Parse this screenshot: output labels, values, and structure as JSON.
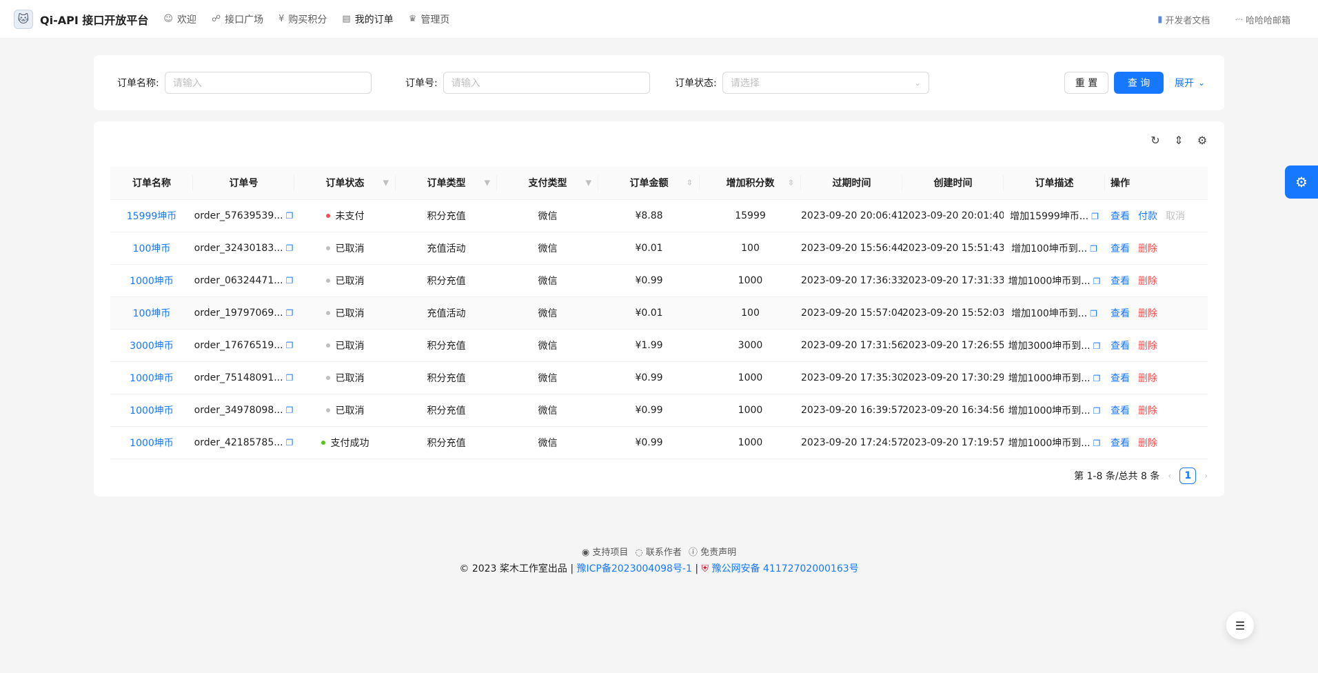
{
  "header": {
    "logo_icon": "cat-logo-icon",
    "title": "Qi-API 接口开放平台",
    "nav": [
      {
        "icon": "smile-icon",
        "glyph": "☺",
        "label": "欢迎"
      },
      {
        "icon": "api-icon",
        "glyph": "☍",
        "label": "接口广场"
      },
      {
        "icon": "yen-icon",
        "glyph": "¥",
        "label": "购买积分"
      },
      {
        "icon": "order-icon",
        "glyph": "▤",
        "label": "我的订单"
      },
      {
        "icon": "crown-icon",
        "glyph": "♛",
        "label": "管理页"
      }
    ],
    "docs_label": "开发者文档",
    "user_label": "哈哈哈邮箱"
  },
  "search": {
    "order_name_label": "订单名称:",
    "order_name_placeholder": "请输入",
    "order_no_label": "订单号:",
    "order_no_placeholder": "请输入",
    "order_status_label": "订单状态:",
    "order_status_placeholder": "请选择",
    "reset_label": "重 置",
    "query_label": "查 询",
    "expand_label": "展开"
  },
  "table": {
    "columns": [
      "订单名称",
      "订单号",
      "订单状态",
      "订单类型",
      "支付类型",
      "订单金额",
      "增加积分数",
      "过期时间",
      "创建时间",
      "订单描述",
      "操作"
    ],
    "rows": [
      {
        "name": "15999坤币",
        "no": "order_57639539...",
        "status": "未支付",
        "status_color": "#ff4d4f",
        "type": "积分充值",
        "pay": "微信",
        "amount": "¥8.88",
        "points": "15999",
        "expire": "2023-09-20 20:06:41",
        "created": "2023-09-20 20:01:40",
        "desc": "增加15999坤币...",
        "a1": "查看",
        "a2": "付款",
        "a3": "取消"
      },
      {
        "name": "100坤币",
        "no": "order_32430183...",
        "status": "已取消",
        "status_color": "#bfbfbf",
        "type": "充值活动",
        "pay": "微信",
        "amount": "¥0.01",
        "points": "100",
        "expire": "2023-09-20 15:56:44",
        "created": "2023-09-20 15:51:43",
        "desc": "增加100坤币到...",
        "a1": "查看",
        "a2": "删除"
      },
      {
        "name": "1000坤币",
        "no": "order_06324471...",
        "status": "已取消",
        "status_color": "#bfbfbf",
        "type": "积分充值",
        "pay": "微信",
        "amount": "¥0.99",
        "points": "1000",
        "expire": "2023-09-20 17:36:33",
        "created": "2023-09-20 17:31:33",
        "desc": "增加1000坤币到...",
        "a1": "查看",
        "a2": "删除"
      },
      {
        "name": "100坤币",
        "no": "order_19797069...",
        "status": "已取消",
        "status_color": "#bfbfbf",
        "type": "充值活动",
        "pay": "微信",
        "amount": "¥0.01",
        "points": "100",
        "expire": "2023-09-20 15:57:04",
        "created": "2023-09-20 15:52:03",
        "desc": "增加100坤币到...",
        "a1": "查看",
        "a2": "删除"
      },
      {
        "name": "3000坤币",
        "no": "order_17676519...",
        "status": "已取消",
        "status_color": "#bfbfbf",
        "type": "积分充值",
        "pay": "微信",
        "amount": "¥1.99",
        "points": "3000",
        "expire": "2023-09-20 17:31:56",
        "created": "2023-09-20 17:26:55",
        "desc": "增加3000坤币到...",
        "a1": "查看",
        "a2": "删除"
      },
      {
        "name": "1000坤币",
        "no": "order_75148091...",
        "status": "已取消",
        "status_color": "#bfbfbf",
        "type": "积分充值",
        "pay": "微信",
        "amount": "¥0.99",
        "points": "1000",
        "expire": "2023-09-20 17:35:30",
        "created": "2023-09-20 17:30:29",
        "desc": "增加1000坤币到...",
        "a1": "查看",
        "a2": "删除"
      },
      {
        "name": "1000坤币",
        "no": "order_34978098...",
        "status": "已取消",
        "status_color": "#bfbfbf",
        "type": "积分充值",
        "pay": "微信",
        "amount": "¥0.99",
        "points": "1000",
        "expire": "2023-09-20 16:39:57",
        "created": "2023-09-20 16:34:56",
        "desc": "增加1000坤币到...",
        "a1": "查看",
        "a2": "删除"
      },
      {
        "name": "1000坤币",
        "no": "order_42185785...",
        "status": "支付成功",
        "status_color": "#52c41a",
        "type": "积分充值",
        "pay": "微信",
        "amount": "¥0.99",
        "points": "1000",
        "expire": "2023-09-20 17:24:57",
        "created": "2023-09-20 17:19:57",
        "desc": "增加1000坤币到...",
        "a1": "查看",
        "a2": "删除"
      }
    ]
  },
  "pagination": {
    "summary": "第 1-8 条/总共 8 条",
    "current": "1"
  },
  "footer": {
    "support": "支持项目",
    "contact": "联系作者",
    "disclaimer": "免责声明",
    "copyright": "2023 桨木工作室出品 |",
    "icp": "豫ICP备2023004098号-1",
    "sep": "|",
    "police": "豫公网安备 41172702000163号"
  },
  "colors": {
    "primary": "#1677ff",
    "danger": "#ff4d4f",
    "success": "#52c41a"
  }
}
